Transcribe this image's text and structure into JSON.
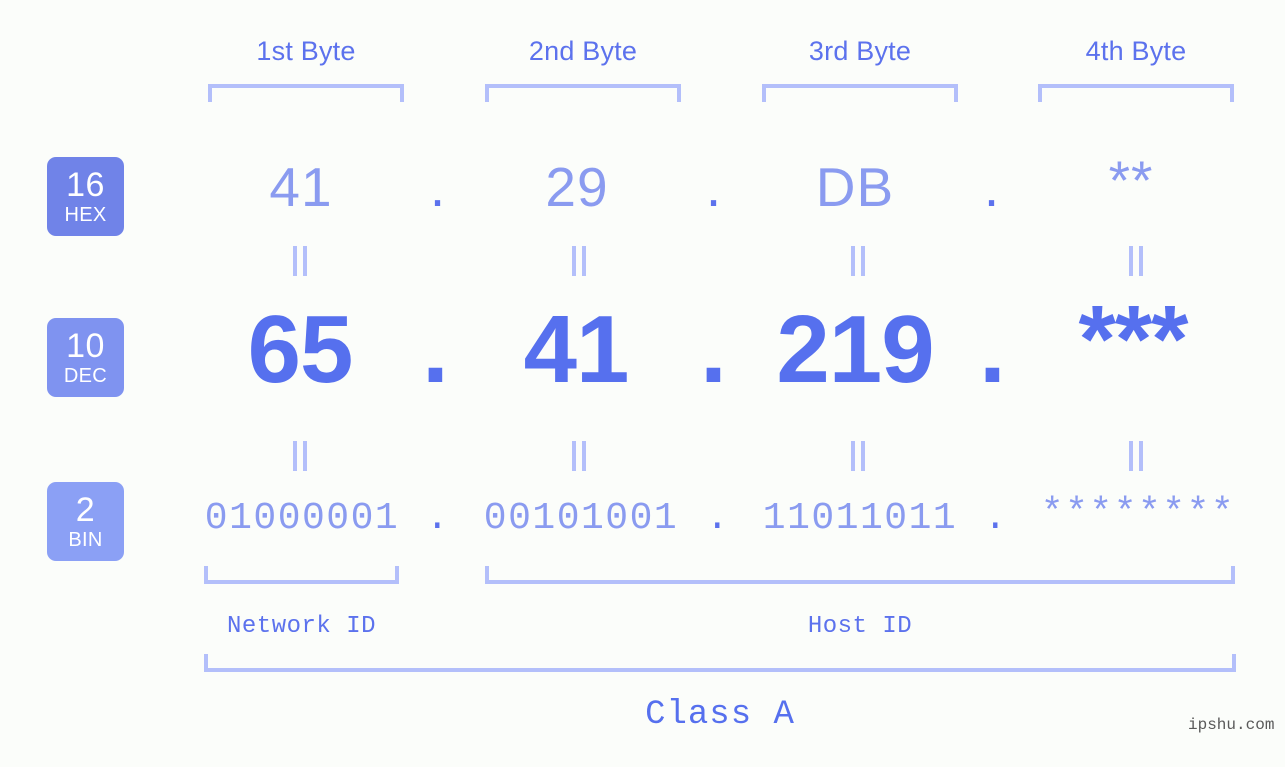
{
  "meta": {
    "background_color": "#fbfdfa",
    "accent_color": "#5670ee",
    "accent_light_color": "#8a9bf0",
    "bracket_color": "#b3bffa"
  },
  "byte_headers": [
    {
      "label": "1st Byte"
    },
    {
      "label": "2nd Byte"
    },
    {
      "label": "3rd Byte"
    },
    {
      "label": "4th Byte"
    }
  ],
  "rows": [
    {
      "badge": {
        "number": "16",
        "name": "HEX",
        "color": "#7083e8"
      },
      "values": [
        "41",
        "29",
        "DB",
        "**"
      ],
      "separator": "."
    },
    {
      "badge": {
        "number": "10",
        "name": "DEC",
        "color": "#7f93f0"
      },
      "values": [
        "65",
        "41",
        "219",
        "***"
      ],
      "separator": "."
    },
    {
      "badge": {
        "number": "2",
        "name": "BIN",
        "color": "#8ba0f5"
      },
      "values": [
        "01000001",
        "00101001",
        "11011011",
        "********"
      ],
      "separator": "."
    }
  ],
  "equality_marks": {
    "glyph": "||",
    "count_per_row": 4
  },
  "sections": [
    {
      "label": "Network ID"
    },
    {
      "label": "Host ID"
    }
  ],
  "class_label": "Class A",
  "watermark": "ipshu.com"
}
